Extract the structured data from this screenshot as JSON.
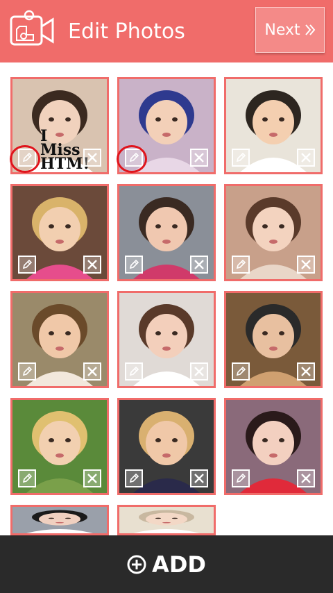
{
  "header": {
    "title": "Edit Photos",
    "next_label": "Next",
    "next_icon": "double-chevron-right-icon",
    "background": "#f06c6a"
  },
  "photos": [
    {
      "name": "baby-i-miss-you",
      "caption_lines": [
        "I",
        "Miss",
        "HTM!"
      ],
      "highlighted_edit": true
    },
    {
      "name": "baby-sunglasses-lying",
      "highlighted_edit": true
    },
    {
      "name": "baby-white-hat"
    },
    {
      "name": "girl-blonde-flower"
    },
    {
      "name": "girl-dark-hair"
    },
    {
      "name": "girl-blue-eyes"
    },
    {
      "name": "baby-lion-costume"
    },
    {
      "name": "girl-brown-eyes"
    },
    {
      "name": "baby-headphones"
    },
    {
      "name": "girl-blonde-pout"
    },
    {
      "name": "girl-chin-on-hands"
    },
    {
      "name": "baby-headband-red"
    },
    {
      "name": "baby-partial-dark"
    },
    {
      "name": "baby-partial-light"
    }
  ],
  "tile_icons": {
    "edit": "pencil-icon",
    "delete": "close-icon"
  },
  "bottom_bar": {
    "add_label": "ADD",
    "add_icon": "plus-circle-icon",
    "background": "#2a2a2a"
  },
  "accent_color": "#f06c6a",
  "highlight_color": "#e0141c"
}
